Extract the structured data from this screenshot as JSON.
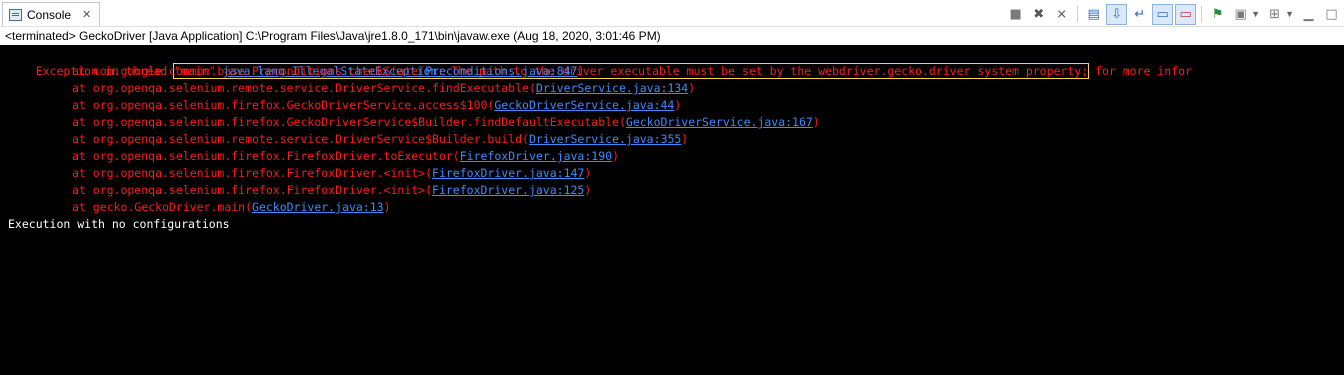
{
  "tab": {
    "label": "Console",
    "icon": "console-icon",
    "close_glyph": "✕"
  },
  "toolbar": {
    "buttons": [
      {
        "name": "terminate-button",
        "icon": "stop-icon"
      },
      {
        "name": "remove-launch-button",
        "icon": "remove-icon"
      },
      {
        "name": "remove-all-button",
        "icon": "remove-all-icon"
      },
      {
        "name": "clear-console-button",
        "icon": "clear-icon"
      },
      {
        "name": "scroll-lock-button",
        "icon": "scroll-lock-icon"
      },
      {
        "name": "word-wrap-button",
        "icon": "word-wrap-icon"
      },
      {
        "name": "show-stdout-button",
        "icon": "stdout-icon"
      },
      {
        "name": "show-stderr-button",
        "icon": "stderr-icon"
      },
      {
        "name": "pin-console-button",
        "icon": "pin-icon"
      },
      {
        "name": "display-console-button",
        "icon": "display-icon"
      },
      {
        "name": "open-console-button",
        "icon": "open-console-icon"
      },
      {
        "name": "view-menu-button",
        "icon": "view-menu-icon"
      }
    ]
  },
  "status": "<terminated> GeckoDriver [Java Application] C:\\Program Files\\Java\\jre1.8.0_171\\bin\\javaw.exe (Aug 18, 2020, 3:01:46 PM)",
  "console": {
    "exception_prefix": "Exception in thread ",
    "thread_name": "\"main\"",
    "exception_class": "java.lang.IllegalStateException",
    "exception_message": ": The path to the driver executable must be set by the webdriver.gecko.driver system property;",
    "exception_suffix": " for more infor",
    "stack": [
      {
        "text": "at com.google.common.base.Preconditions.checkState(",
        "link": "Preconditions.java:847",
        "end": ")"
      },
      {
        "text": "at org.openqa.selenium.remote.service.DriverService.findExecutable(",
        "link": "DriverService.java:134",
        "end": ")"
      },
      {
        "text": "at org.openqa.selenium.firefox.GeckoDriverService.access$100(",
        "link": "GeckoDriverService.java:44",
        "end": ")"
      },
      {
        "text": "at org.openqa.selenium.firefox.GeckoDriverService$Builder.findDefaultExecutable(",
        "link": "GeckoDriverService.java:167",
        "end": ")"
      },
      {
        "text": "at org.openqa.selenium.remote.service.DriverService$Builder.build(",
        "link": "DriverService.java:355",
        "end": ")"
      },
      {
        "text": "at org.openqa.selenium.firefox.FirefoxDriver.toExecutor(",
        "link": "FirefoxDriver.java:190",
        "end": ")"
      },
      {
        "text": "at org.openqa.selenium.firefox.FirefoxDriver.<init>(",
        "link": "FirefoxDriver.java:147",
        "end": ")"
      },
      {
        "text": "at org.openqa.selenium.firefox.FirefoxDriver.<init>(",
        "link": "FirefoxDriver.java:125",
        "end": ")"
      },
      {
        "text": "at gecko.GeckoDriver.main(",
        "link": "GeckoDriver.java:13",
        "end": ")"
      }
    ],
    "output": "Execution with no configurations"
  },
  "colors": {
    "error": "#ff1a1a",
    "link": "#3d8bff",
    "stdout": "#ffffff",
    "background": "#000000",
    "highlight": "#ffd24d"
  }
}
